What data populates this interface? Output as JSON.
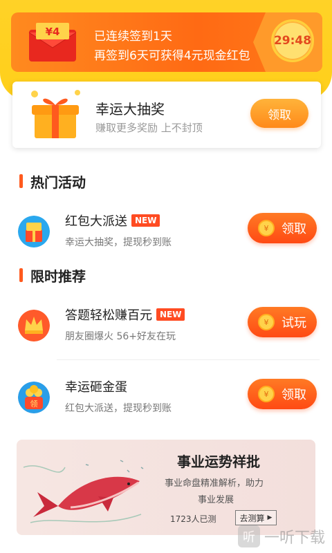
{
  "signin": {
    "envelope_amount": "¥4",
    "line1": "已连续签到1天",
    "line2": "再签到6天可获得4元现金红包",
    "timer": "29:48"
  },
  "lucky_draw": {
    "title": "幸运大抽奖",
    "subtitle": "赚取更多奖励 上不封顶",
    "button": "领取"
  },
  "sections": {
    "hot": "热门活动",
    "recommend": "限时推荐"
  },
  "activities": [
    {
      "title": "红包大派送",
      "badge": "NEW",
      "subtitle": "幸运大抽奖，提现秒到账",
      "button": "领取",
      "coin": "¥"
    },
    {
      "title": "答题轻松赚百元",
      "badge": "NEW",
      "subtitle": "朋友圈爆火 56+好友在玩",
      "button": "试玩",
      "coin": "¥"
    },
    {
      "title": "幸运砸金蛋",
      "badge": "",
      "subtitle": "红包大派送，提现秒到账",
      "button": "领取",
      "coin": "¥",
      "icon_label": "领"
    }
  ],
  "ad": {
    "title": "事业运势祥批",
    "line1": "事业命盘精准解析，助力",
    "line2": "事业发展",
    "count": "1723人已测",
    "button": "去测算"
  },
  "watermark": {
    "icon": "听",
    "text": "一听下载"
  },
  "colors": {
    "accent_orange": "#ff5a1e",
    "yellow": "#ffd227",
    "badge_red": "#ff4b22"
  }
}
